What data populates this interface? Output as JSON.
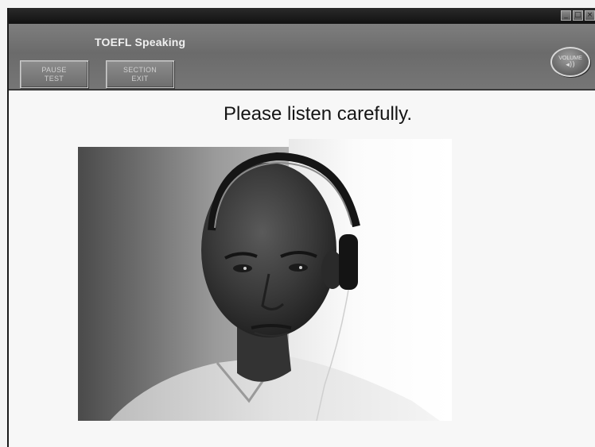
{
  "window": {
    "controls": [
      "_",
      "□",
      "×"
    ]
  },
  "header": {
    "title": "TOEFL Speaking",
    "pause_button": {
      "line1": "PAUSE",
      "line2": "TEST"
    },
    "section_exit_button": {
      "line1": "SECTION",
      "line2": "EXIT"
    },
    "volume_button": {
      "label": "VOLUME",
      "icon": "speaker-icon",
      "glyph": "◂))"
    }
  },
  "main": {
    "prompt": "Please listen carefully."
  },
  "colors": {
    "header_gray": "#6b6b6b",
    "titlebar": "#121212",
    "background": "#f7f7f7"
  }
}
